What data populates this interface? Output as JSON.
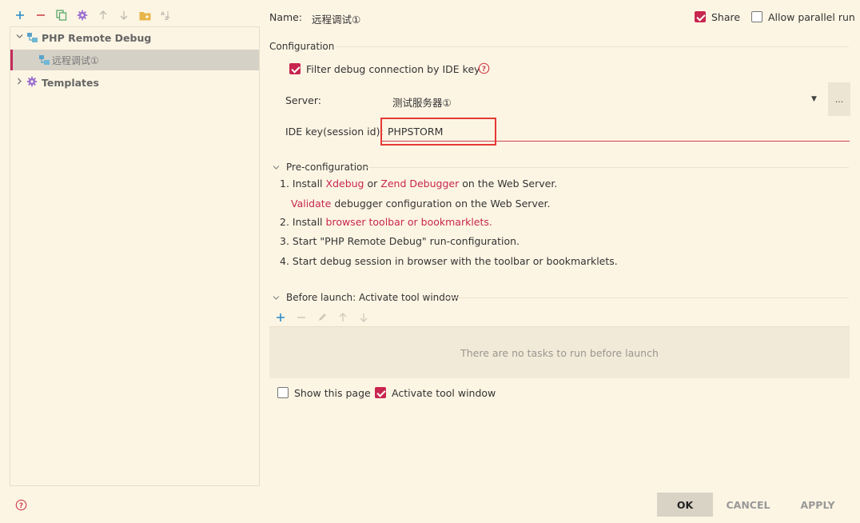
{
  "toolbar": {
    "add_icon": "plus-icon",
    "remove_icon": "minus-icon",
    "copy_icon": "copy-icon",
    "settings_icon": "gear-icon",
    "up_icon": "arrow-up-icon",
    "down_icon": "arrow-down-icon",
    "folder_icon": "folder-icon",
    "sort_icon": "sort-az-icon"
  },
  "tree": {
    "group_label": "PHP Remote Debug",
    "child_label": "远程调试①",
    "templates_label": "Templates"
  },
  "header": {
    "name_label": "Name:",
    "name_value": "远程调试①",
    "share_label": "Share",
    "share_checked": true,
    "parallel_label": "Allow parallel run",
    "parallel_checked": false
  },
  "configuration": {
    "section_title": "Configuration",
    "filter_label": "Filter debug connection by IDE key",
    "filter_checked": true,
    "server_label": "Server:",
    "server_value": "测试服务器①",
    "server_more": "...",
    "ide_key_label": "IDE key(session id):",
    "ide_key_value": "PHPSTORM"
  },
  "preconfig": {
    "section_title": "Pre-configuration",
    "step1_prefix": "1. Install",
    "xdebug": "Xdebug",
    "or": "or",
    "zend": "Zend Debugger",
    "step1_suffix": "on the Web Server.",
    "validate": "Validate",
    "validate_suffix": "debugger configuration on the Web Server.",
    "step2_prefix": "2. Install",
    "step2_link": "browser toolbar or bookmarklets",
    "step2_suffix": ".",
    "step3": "3. Start \"PHP Remote Debug\" run-configuration.",
    "step4": "4. Start debug session in browser with the toolbar or bookmarklets."
  },
  "before_launch": {
    "section_title": "Before launch: Activate tool window",
    "empty_text": "There are no tasks to run before launch",
    "show_page_label": "Show this page",
    "show_page_checked": false,
    "activate_label": "Activate tool window",
    "activate_checked": true
  },
  "footer": {
    "help_icon": "help-icon",
    "ok": "OK",
    "cancel": "CANCEL",
    "apply": "APPLY"
  },
  "colors": {
    "background": "#fdf5e4",
    "accent": "#c8264f",
    "selection": "#d5d1c6"
  }
}
